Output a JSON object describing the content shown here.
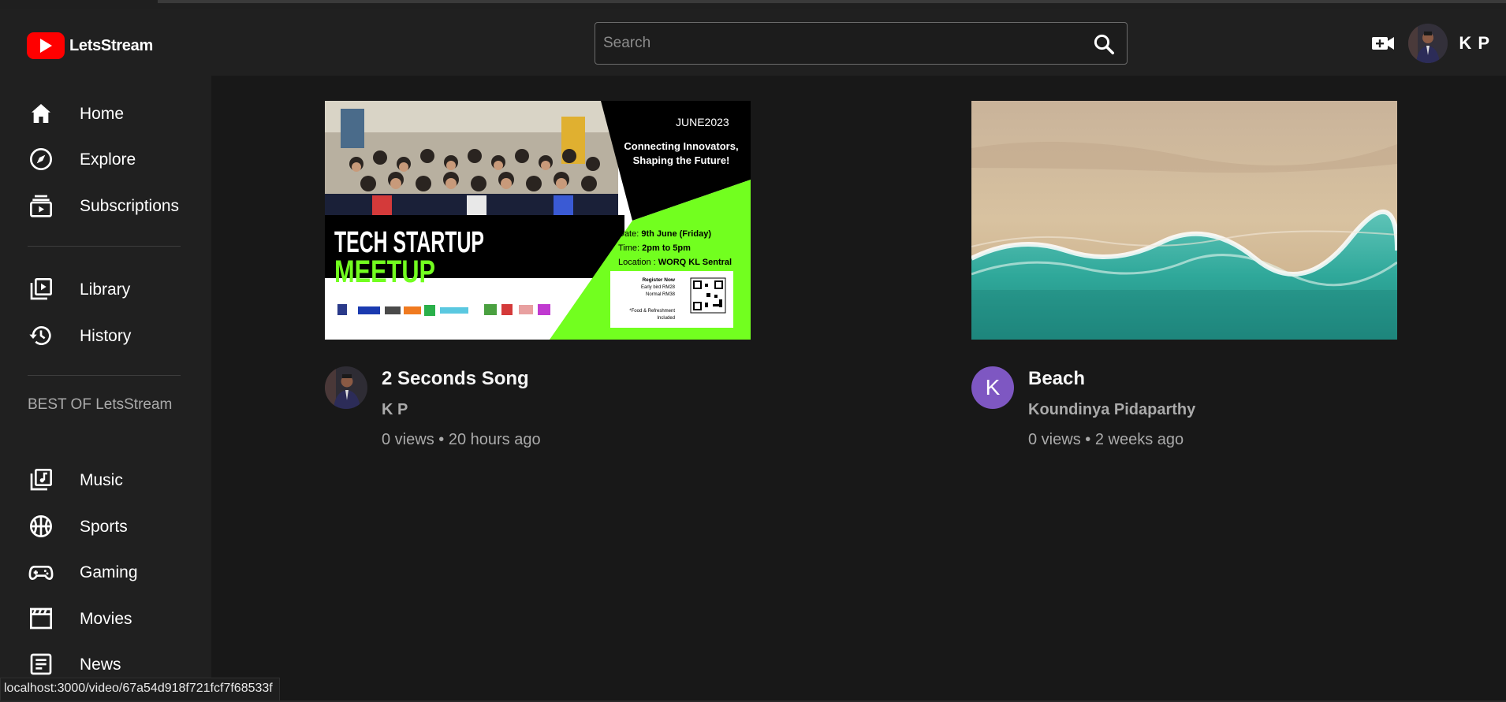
{
  "app": {
    "name": "LetsStream"
  },
  "header": {
    "search_placeholder": "Search",
    "user_name": "K P"
  },
  "sidebar": {
    "primary": [
      {
        "label": "Home",
        "icon": "home-icon"
      },
      {
        "label": "Explore",
        "icon": "compass-icon"
      },
      {
        "label": "Subscriptions",
        "icon": "subscriptions-icon"
      }
    ],
    "secondary": [
      {
        "label": "Library",
        "icon": "library-icon"
      },
      {
        "label": "History",
        "icon": "history-icon"
      }
    ],
    "best_of_title": "BEST OF LetsStream",
    "best_of": [
      {
        "label": "Music",
        "icon": "music-icon"
      },
      {
        "label": "Sports",
        "icon": "sports-icon"
      },
      {
        "label": "Gaming",
        "icon": "gaming-icon"
      },
      {
        "label": "Movies",
        "icon": "movies-icon"
      },
      {
        "label": "News",
        "icon": "news-icon"
      }
    ]
  },
  "videos": [
    {
      "title": "2 Seconds Song",
      "channel": "K P",
      "views": "0 views",
      "age": "20 hours ago",
      "thumbnail": {
        "month": "JUNE2023",
        "tagline_1": "Connecting Innovators,",
        "tagline_2": "Shaping the Future!",
        "headline_1": "TECH STARTUP",
        "headline_2": "MEETUP",
        "date_label": "Date:",
        "date_value": "9th June (Friday)",
        "time_label": "Time:",
        "time_value": "2pm to 5pm",
        "location_label": "Location :",
        "location_value": "WORQ KL Sentral",
        "register": "Register Now",
        "early_bird": "Early bird RM28",
        "normal": "Normal RM38",
        "food": "*Food & Refreshment",
        "included": "Included"
      }
    },
    {
      "title": "Beach",
      "channel": "Koundinya Pidaparthy",
      "avatar_letter": "K",
      "views": "0 views",
      "age": "2 weeks ago"
    }
  ],
  "status_bar": {
    "url": "localhost:3000/video/67a54d918f721fcf7f68533f"
  },
  "colors": {
    "brand": "#ff0000",
    "accent_green": "#72ff1f",
    "avatar_purple": "#7e57c2"
  }
}
